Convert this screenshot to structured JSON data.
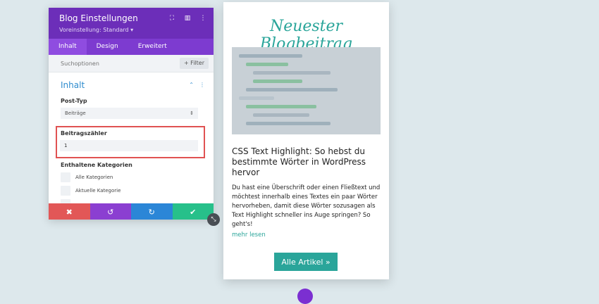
{
  "colors": {
    "purple_header": "#6c2eb9",
    "purple_tabs": "#7d3bd0",
    "accent_blue": "#2f8cce",
    "teal": "#2aa59a",
    "cancel_red": "#e25757",
    "undo_purple": "#8b3fd1",
    "redo_blue": "#2b86d7",
    "save_green": "#27c08a",
    "highlight_red": "#e05252"
  },
  "panel": {
    "title": "Blog Einstellungen",
    "preset": "Voreinstellung: Standard ▾",
    "icons": [
      "expand-icon",
      "columns-icon",
      "more-vertical-icon"
    ],
    "tabs": [
      {
        "label": "Inhalt",
        "active": true
      },
      {
        "label": "Design",
        "active": false
      },
      {
        "label": "Erweitert",
        "active": false
      }
    ],
    "search_placeholder": "Suchoptionen",
    "filter_label": "+ Filter",
    "section_title": "Inhalt",
    "post_type": {
      "label": "Post-Typ",
      "value": "Beiträge"
    },
    "post_count": {
      "label": "Beitragszähler",
      "value": "1"
    },
    "categories": {
      "label": "Enthaltene Kategorien",
      "items": [
        "Alle Kategorien",
        "Aktuelle Kategorie"
      ]
    },
    "footer": {
      "cancel": "✖",
      "undo": "↺",
      "redo": "↻",
      "save": "✔"
    }
  },
  "card": {
    "heading": "Neuester Blogbeitrag",
    "post_title": "CSS Text Highlight: So hebst du bestimmte Wörter in WordPress hervor",
    "excerpt": "Du hast eine Überschrift oder einen Fließtext und möchtest innerhalb eines Textes ein paar Wörter hervorheben, damit diese Wörter sozusagen als Text Highlight schneller ins Auge springen? So geht's!",
    "more_link": "mehr lesen",
    "all_button": "Alle Artikel »"
  }
}
